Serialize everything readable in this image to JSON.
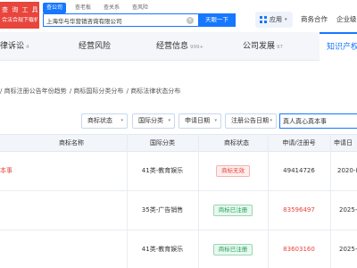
{
  "header": {
    "logo_line1": "查 询 工 具",
    "logo_line2": "合法合规下载机构",
    "scope_tabs": [
      "查公司",
      "查老板",
      "查关系",
      "查风险"
    ],
    "search_value": "上海华与华营销咨询有限公司",
    "clear_glyph": "×",
    "search_button": "天眼一下",
    "app_label": "应用",
    "app_caret": "▾",
    "nav_links": [
      "商务合作",
      "企业级"
    ]
  },
  "section_tabs": [
    {
      "label": "律诉讼",
      "count": "4"
    },
    {
      "label": "经营风险",
      "count": ""
    },
    {
      "label": "经营信息",
      "count": "999+"
    },
    {
      "label": "公司发展",
      "count": "97"
    },
    {
      "label": "知识产权",
      "count": ""
    }
  ],
  "subnav": [
    "/ 商标注册公告年份趋势",
    "/ 商标国际分类分布",
    "/ 商标法律状态分布"
  ],
  "filters": {
    "buttons": [
      "商标状态",
      "国际分类",
      "申请日期",
      "注册公告日期"
    ],
    "caret": "▾",
    "search_value": "真人真心真本事"
  },
  "table": {
    "headers": [
      "商标名称",
      "国际分类",
      "商标状态",
      "申请/注册号",
      "申请日"
    ],
    "rows": [
      {
        "name": "本事",
        "class": "41类-教育娱乐",
        "status": "商标无效",
        "status_kind": "invalid",
        "regno": "49414726",
        "regno_red": false,
        "date": "2020-("
      },
      {
        "name": "",
        "class": "35类-广告销售",
        "status": "商标已注册",
        "status_kind": "ok",
        "regno": "83596497",
        "regno_red": true,
        "date": "2025-"
      },
      {
        "name": "",
        "class": "41类-教育娱乐",
        "status": "商标已注册",
        "status_kind": "ok",
        "regno": "83603160",
        "regno_red": true,
        "date": "2025-"
      }
    ]
  },
  "colors": {
    "accent": "#1677ff",
    "danger": "#e8453c",
    "success": "#1fa35c"
  }
}
